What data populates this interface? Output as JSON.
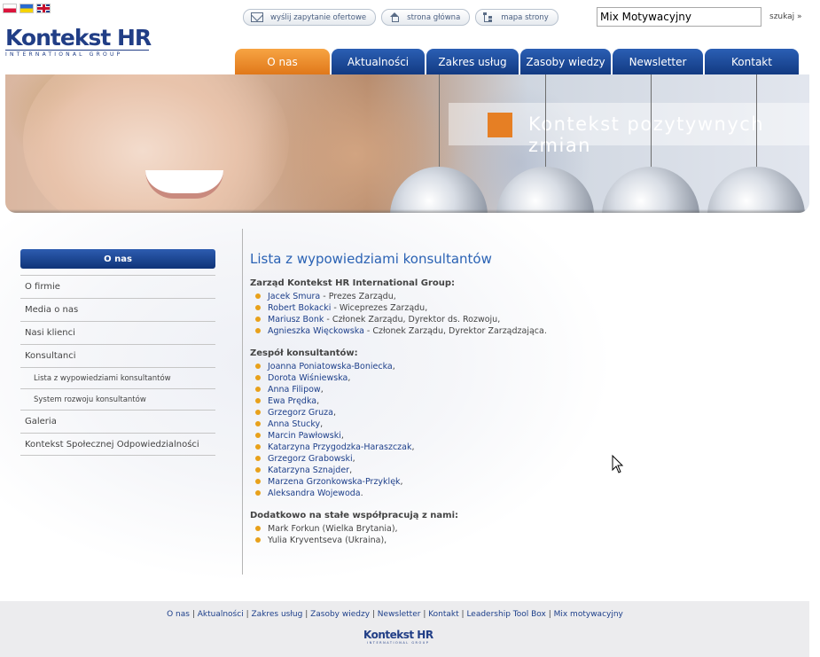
{
  "languages": [
    {
      "name": "pl-flag-icon",
      "cls": "flag-pl"
    },
    {
      "name": "ua-flag-icon",
      "cls": "flag-ua"
    },
    {
      "name": "en-flag-icon",
      "cls": "flag-en"
    }
  ],
  "logo": {
    "main": "Kontekst HR",
    "sub": "INTERNATIONAL GROUP"
  },
  "toplinks": [
    {
      "name": "request-offer-link",
      "icon": "mail-icon",
      "label": "wyślij zapytanie ofertowe"
    },
    {
      "name": "home-link",
      "icon": "home-icon",
      "label": "strona główna"
    },
    {
      "name": "sitemap-link",
      "icon": "sitemap-icon",
      "label": "mapa strony"
    }
  ],
  "search": {
    "value": "Mix Motywacyjny",
    "button": "szukaj »"
  },
  "nav": [
    {
      "label": "O nas",
      "active": true
    },
    {
      "label": "Aktualności",
      "active": false
    },
    {
      "label": "Zakres usług",
      "active": false
    },
    {
      "label": "Zasoby wiedzy",
      "active": false
    },
    {
      "label": "Newsletter",
      "active": false
    },
    {
      "label": "Kontakt",
      "active": false
    }
  ],
  "banner": {
    "slogan": "Kontekst pozytywnych zmian"
  },
  "sidebar": {
    "title": "O nas",
    "items": [
      {
        "label": "O firmie",
        "sub": false
      },
      {
        "label": "Media o nas",
        "sub": false
      },
      {
        "label": "Nasi klienci",
        "sub": false
      },
      {
        "label": "Konsultanci",
        "sub": false
      },
      {
        "label": "Lista z wypowiedziami konsultantów",
        "sub": true
      },
      {
        "label": "System rozwoju konsultantów",
        "sub": true
      },
      {
        "label": "Galeria",
        "sub": false
      },
      {
        "label": "Kontekst Społecznej Odpowiedzialności",
        "sub": false
      }
    ]
  },
  "content": {
    "title": "Lista z wypowiedziami konsultantów",
    "sections": [
      {
        "heading": "Zarząd Kontekst HR International Group:",
        "people": [
          {
            "name": "Jacek Smura",
            "role": " - Prezes Zarządu,",
            "link": true
          },
          {
            "name": "Robert Bokacki",
            "role": " - Wiceprezes Zarządu,",
            "link": true
          },
          {
            "name": "Mariusz Bonk",
            "role": " - Członek Zarządu, Dyrektor ds. Rozwoju,",
            "link": true
          },
          {
            "name": "Agnieszka Więckowska",
            "role": " - Członek Zarządu, Dyrektor Zarządzająca.",
            "link": true
          }
        ]
      },
      {
        "heading": "Zespół konsultantów:",
        "people": [
          {
            "name": "Joanna Poniatowska-Boniecka",
            "role": ",",
            "link": true
          },
          {
            "name": "Dorota Wiśniewska",
            "role": ",",
            "link": true
          },
          {
            "name": "Anna Filipow",
            "role": ",",
            "link": true
          },
          {
            "name": "Ewa Prędka",
            "role": ",",
            "link": true
          },
          {
            "name": "Grzegorz Gruza",
            "role": ",",
            "link": true
          },
          {
            "name": "Anna Stucky",
            "role": ",",
            "link": true
          },
          {
            "name": "Marcin Pawłowski",
            "role": ",",
            "link": true
          },
          {
            "name": "Katarzyna Przygodzka-Haraszczak",
            "role": ",",
            "link": true
          },
          {
            "name": "Grzegorz Grabowski",
            "role": ",",
            "link": true
          },
          {
            "name": "Katarzyna Sznajder",
            "role": ",",
            "link": true
          },
          {
            "name": "Marzena Grzonkowska-Przyklęk",
            "role": ",",
            "link": true
          },
          {
            "name": "Aleksandra Wojewoda",
            "role": ".",
            "link": true
          }
        ]
      },
      {
        "heading": "Dodatkowo na stałe współpracują z nami:",
        "people": [
          {
            "name": "Mark Forkun (Wielka Brytania),",
            "role": "",
            "link": false
          },
          {
            "name": "Yulia Kryventseva (Ukraina),",
            "role": "",
            "link": false
          }
        ]
      }
    ]
  },
  "footer": {
    "links": [
      "O nas",
      "Aktualności",
      "Zakres usług",
      "Zasoby wiedzy",
      "Newsletter",
      "Kontakt",
      "Leadership Tool Box",
      "Mix motywacyjny"
    ],
    "separator": " | ",
    "logo": {
      "main": "Kontekst HR",
      "sub": "INTERNATIONAL GROUP"
    }
  }
}
